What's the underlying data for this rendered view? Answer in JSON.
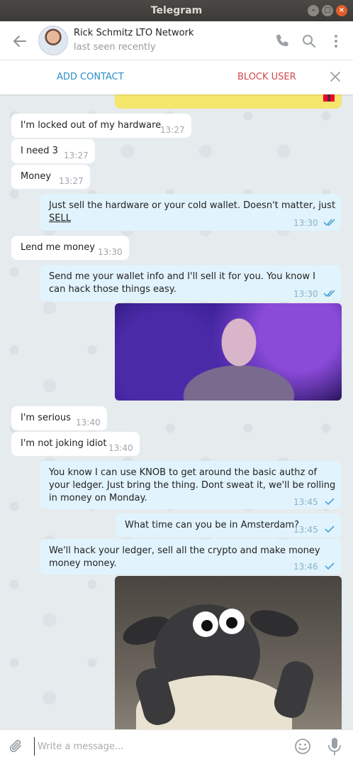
{
  "window": {
    "title": "Telegram"
  },
  "header": {
    "contact_name": "Rick Schmitz LTO Network",
    "status": "last seen recently"
  },
  "actionbar": {
    "add_contact": "ADD CONTACT",
    "block_user": "BLOCK USER"
  },
  "messages": [
    {
      "dir": "in",
      "text": "I'm locked out of my hardware",
      "time": "13:27"
    },
    {
      "dir": "in",
      "text": "I need 3",
      "time": "13:27"
    },
    {
      "dir": "in",
      "text": "Money",
      "time": "13:27"
    },
    {
      "dir": "out",
      "text_a": "Just sell the hardware or your cold wallet. Doesn't matter, just",
      "text_b": "SELL",
      "time": "13:30",
      "read": true
    },
    {
      "dir": "in",
      "text": "Lend me money",
      "time": "13:30"
    },
    {
      "dir": "out",
      "text": "Send me your wallet info and I'll sell it for you. You know I can hack those things easy.",
      "time": "13:30",
      "read": true
    },
    {
      "dir": "in",
      "text": "I'm serious",
      "time": "13:40"
    },
    {
      "dir": "in",
      "text": "I'm not joking idiot",
      "time": "13:40"
    },
    {
      "dir": "out",
      "text": "You know I can use KNOB to get around the basic authz of your ledger. Just bring the thing. Dont sweat it, we'll be rolling in money on Monday.",
      "time": "13:45",
      "read": false
    },
    {
      "dir": "out",
      "text": "What time can you be in Amsterdam?",
      "time": "13:45",
      "read": false
    },
    {
      "dir": "out",
      "text": "We'll hack your ledger, sell all the crypto and make money money money.",
      "time": "13:46",
      "read": false
    }
  ],
  "composer": {
    "placeholder": "Write a message..."
  },
  "colors": {
    "accent": "#2c8ec7",
    "danger": "#d24949",
    "out_bubble": "#e1f3fc",
    "in_bubble": "#ffffff"
  }
}
